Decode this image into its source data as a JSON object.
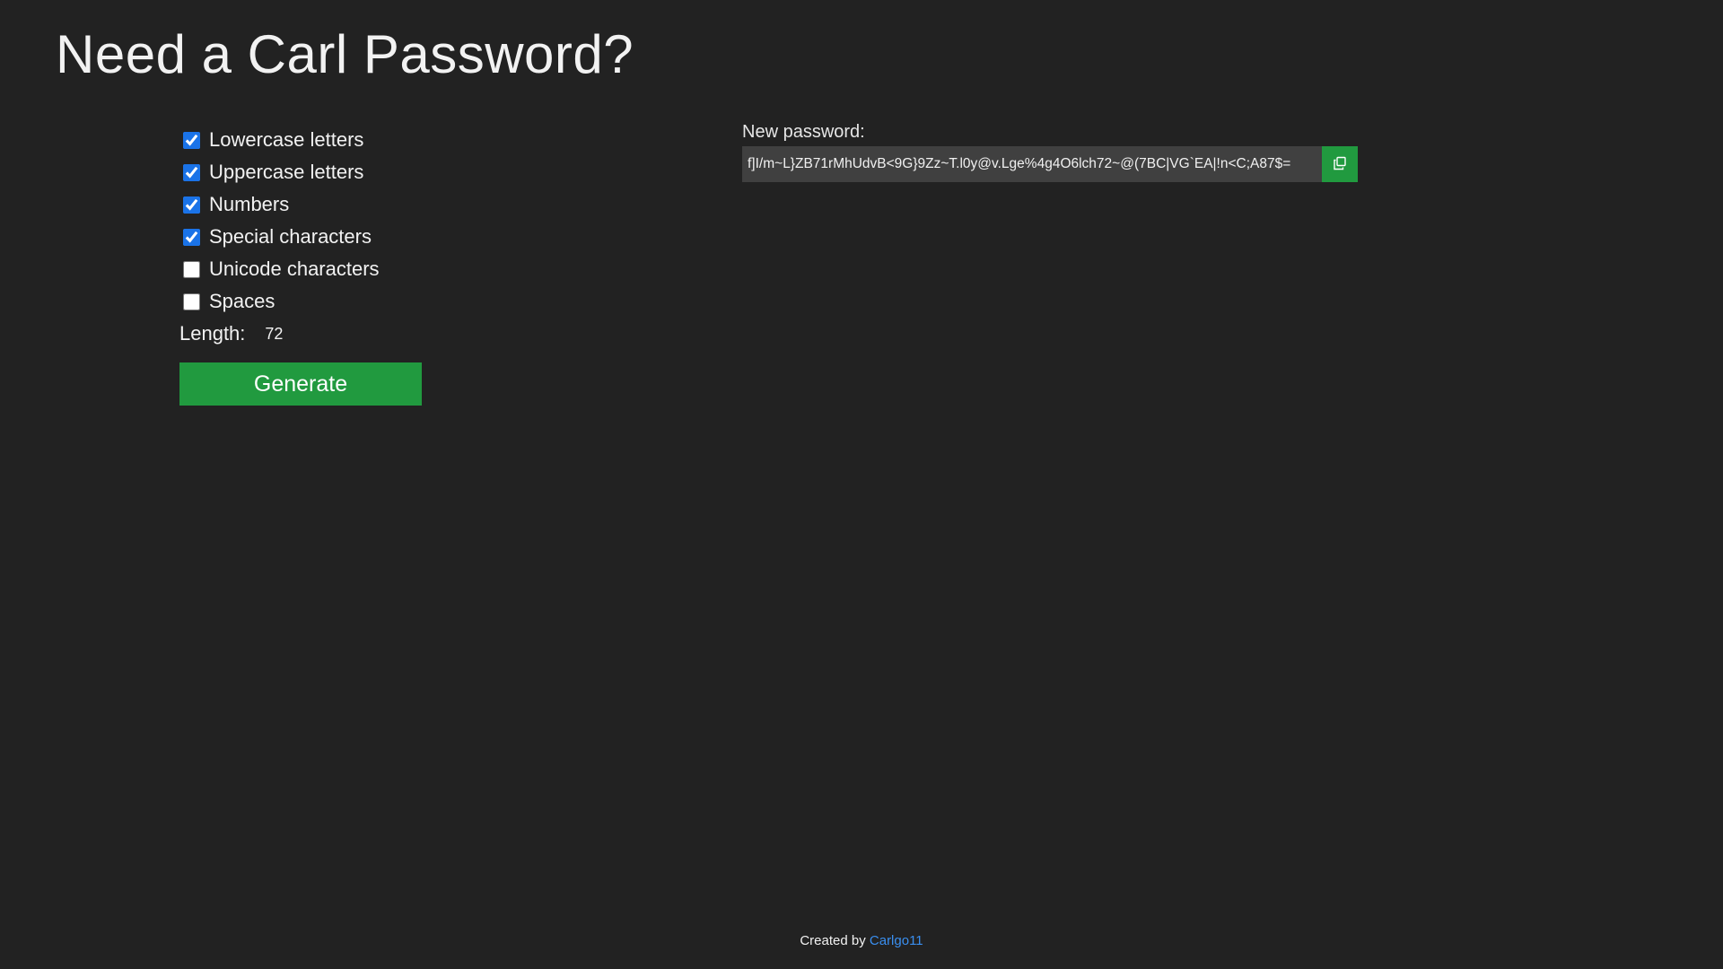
{
  "title": "Need a Carl Password?",
  "options": [
    {
      "label": "Lowercase letters",
      "checked": true
    },
    {
      "label": "Uppercase letters",
      "checked": true
    },
    {
      "label": "Numbers",
      "checked": true
    },
    {
      "label": "Special characters",
      "checked": true
    },
    {
      "label": "Unicode characters",
      "checked": false
    },
    {
      "label": "Spaces",
      "checked": false
    }
  ],
  "length": {
    "label": "Length:",
    "value": "72"
  },
  "generate_label": "Generate",
  "password": {
    "label": "New password:",
    "value": "f]I/m~L}ZB71rMhUdvB<9G}9Zz~T.l0y@v.Lge%4g4O6lch72~@(7BC|VG`EA|!n<C;A87$="
  },
  "copy_icon": "copy-icon",
  "footer": {
    "prefix": "Created by",
    "author": "Carlgo11"
  },
  "colors": {
    "background": "#222222",
    "accent_green": "#219a3f",
    "link_blue": "#3a8ff0",
    "checkbox_blue": "#1a73e8",
    "field_bg": "#404040"
  }
}
